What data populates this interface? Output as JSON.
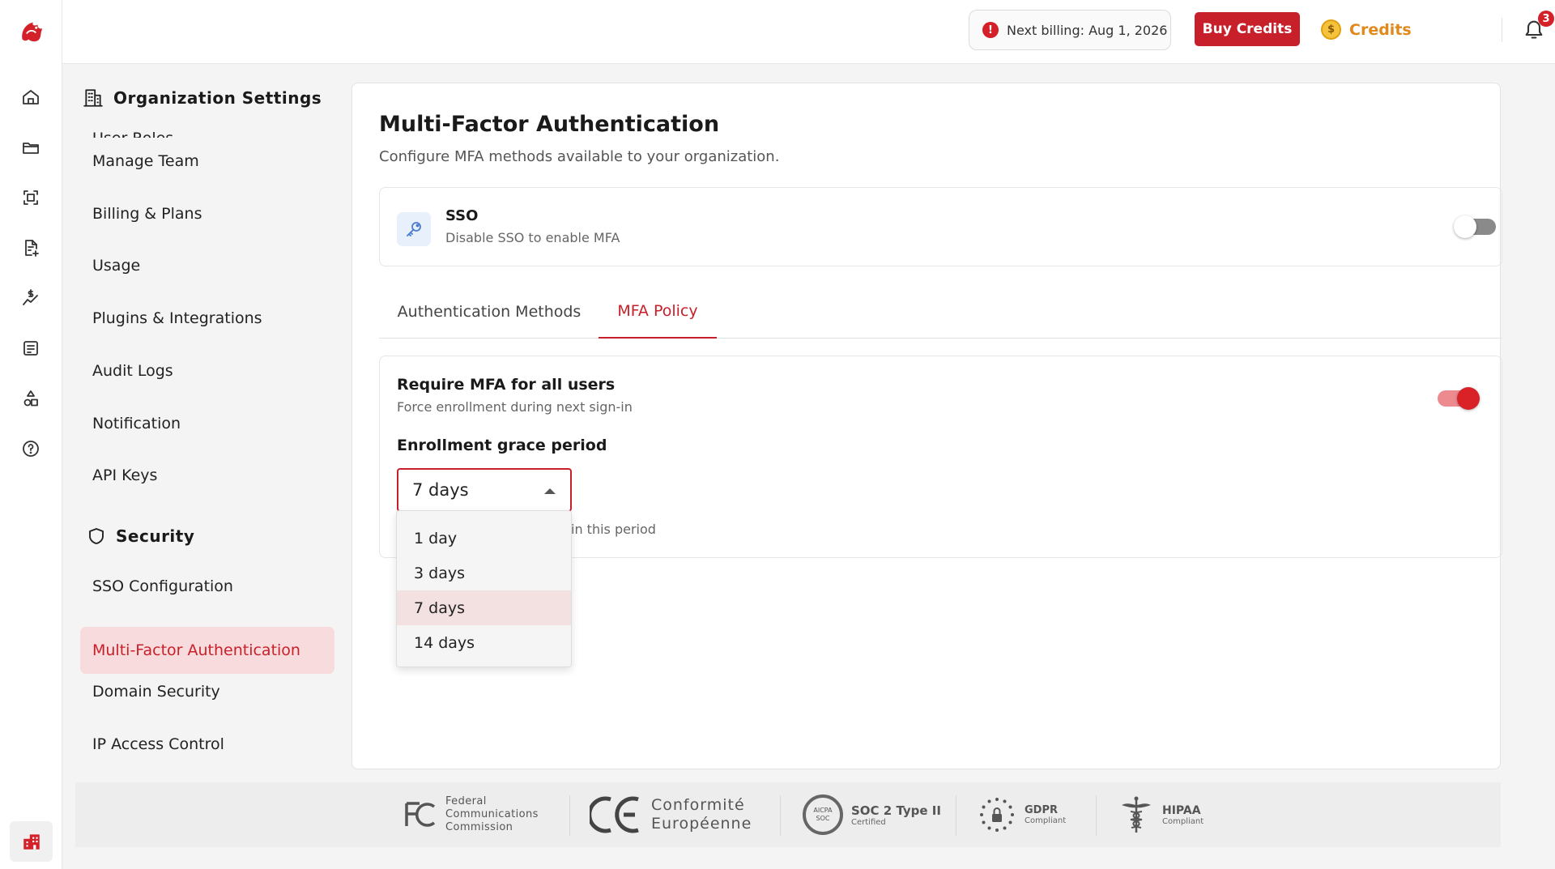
{
  "topbar": {
    "billing_text": "Next billing: Aug 1, 2026",
    "buy_credits_label": "Buy Credits",
    "credits_label": "Credits",
    "notification_count": "3"
  },
  "settings_nav": {
    "header": "Organization Settings",
    "clipped_item": "User Roles",
    "items": [
      {
        "label": "Manage Team"
      },
      {
        "label": "Billing & Plans"
      },
      {
        "label": "Usage"
      },
      {
        "label": "Plugins & Integrations"
      },
      {
        "label": "Audit Logs"
      },
      {
        "label": "Notification"
      },
      {
        "label": "API Keys"
      }
    ],
    "security_header": "Security",
    "security_items": [
      {
        "label": "SSO Configuration",
        "active": false
      },
      {
        "label": "Multi-Factor Authentication",
        "active": true
      },
      {
        "label": "Domain Security",
        "active": false
      },
      {
        "label": "IP Access Control",
        "active": false
      }
    ]
  },
  "main": {
    "title": "Multi-Factor Authentication",
    "subtitle": "Configure MFA methods available to your organization.",
    "sso": {
      "title": "SSO",
      "description": "Disable SSO to enable MFA",
      "enabled": false
    },
    "tabs": [
      {
        "label": "Authentication Methods",
        "active": false
      },
      {
        "label": "MFA Policy",
        "active": true
      }
    ],
    "policy": {
      "require_title": "Require MFA for all users",
      "require_desc": "Force enrollment during next sign-in",
      "require_enabled": true,
      "grace_label": "Enrollment grace period",
      "grace_value": "7 days",
      "helper_text": "in this period",
      "options": [
        "1 day",
        "3 days",
        "7 days",
        "14 days"
      ]
    }
  },
  "footer": {
    "fcc_line1": "Federal",
    "fcc_line2": "Communications",
    "fcc_line3": "Commission",
    "ce_line1": "Conformité",
    "ce_line2": "Européenne",
    "soc_title": "SOC 2 Type II",
    "soc_sub": "Certified",
    "soc_seal": "AICPA",
    "soc_seal2": "SOC",
    "gdpr_title": "GDPR",
    "gdpr_sub": "Compliant",
    "hipaa_title": "HIPAA",
    "hipaa_sub": "Compliant"
  },
  "colors": {
    "brand": "#c8202a",
    "active_bg": "#f8dcdd",
    "credits": "#e08a1e"
  }
}
